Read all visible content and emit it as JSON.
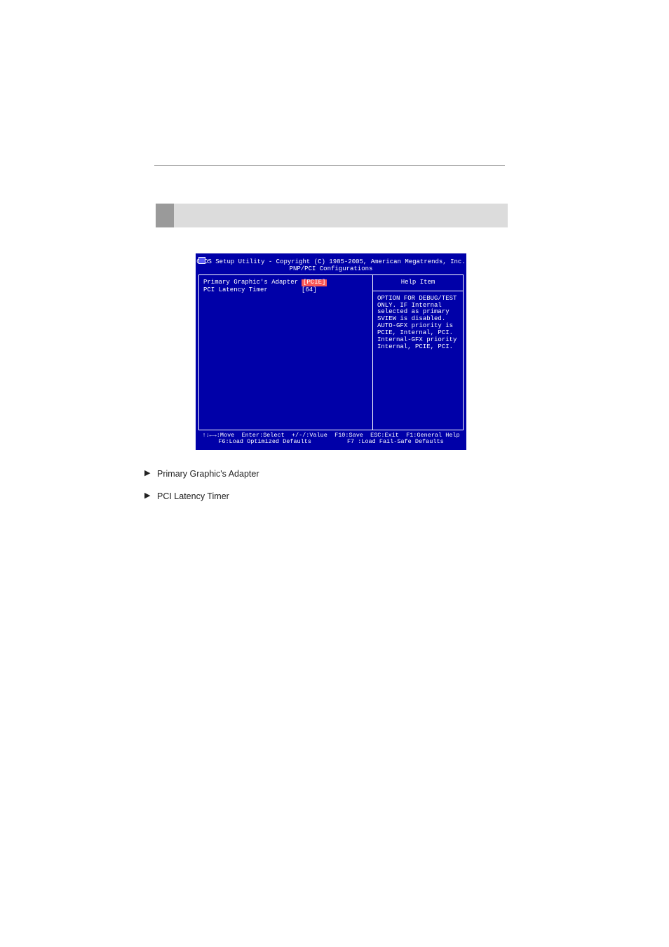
{
  "bios": {
    "title_line1": "CMOS Setup Utility - Copyright (C) 1985-2005, American Megatrends, Inc.",
    "title_line2": "PNP/PCI Configurations",
    "settings": [
      {
        "label": "Primary Graphic's Adapter",
        "value": "[PCIE]",
        "highlighted": true
      },
      {
        "label": "PCI Latency Timer",
        "value": "[64]",
        "highlighted": false
      }
    ],
    "help_header": "Help Item",
    "help_lines": [
      "OPTION FOR DEBUG/TEST",
      "ONLY. IF Internal",
      "selected as primary",
      "SVIEW is disabled.",
      "AUTO-GFX priority is",
      "PCIE, Internal, PCI.",
      "Internal-GFX priority",
      "Internal, PCIE, PCI."
    ],
    "footer_line1": "↑↓←→:Move  Enter:Select  +/-/:Value  F10:Save  ESC:Exit  F1:General Help",
    "footer_line2": "F6:Load Optimized Defaults          F7 :Load Fail-Safe Defaults"
  },
  "descriptions": [
    {
      "label": "Primary Graphic's Adapter",
      "text": ""
    },
    {
      "label": "PCI Latency Timer",
      "text": ""
    }
  ]
}
